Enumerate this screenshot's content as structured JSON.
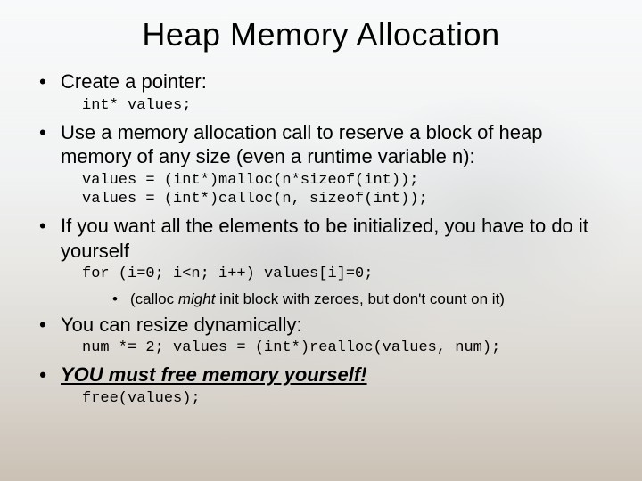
{
  "title": "Heap Memory Allocation",
  "items": {
    "b1": "Create a pointer:",
    "c1": "int* values;",
    "b2": "Use a memory allocation call to reserve a block of heap memory of any size (even a runtime variable n):",
    "c2": "values = (int*)malloc(n*sizeof(int));\nvalues = (int*)calloc(n, sizeof(int));",
    "b3": "If you want all the elements to be initialized, you have to do it yourself",
    "c3": "for (i=0; i<n; i++) values[i]=0;",
    "sub_pre": "(calloc ",
    "sub_em": "might",
    "sub_post": " init block with zeroes, but don't count on it)",
    "b4": "You can resize dynamically:",
    "c4": "num *= 2; values = (int*)realloc(values, num);",
    "b5": "YOU must free memory yourself!",
    "c5": "free(values);"
  }
}
